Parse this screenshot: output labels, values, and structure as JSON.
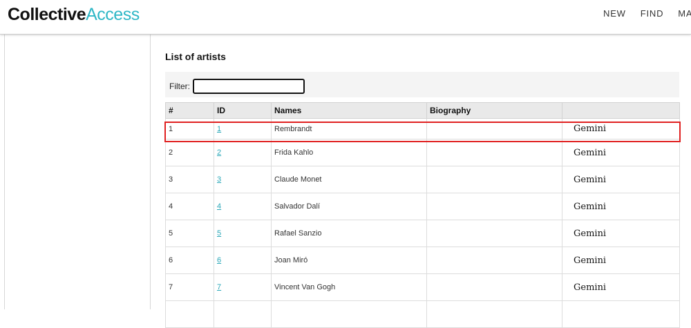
{
  "app": {
    "logo_part1": "Collective",
    "logo_part2": "Access"
  },
  "nav": {
    "items": [
      "NEW",
      "FIND",
      "MAN"
    ]
  },
  "page": {
    "heading": "List of artists"
  },
  "filter": {
    "label": "Filter:",
    "value": ""
  },
  "table": {
    "headers": [
      "#",
      "ID",
      "Names",
      "Biography",
      ""
    ],
    "rows": [
      {
        "num": "1",
        "id": "1",
        "name": "Rembrandt",
        "bio": "",
        "logo": "Gemini"
      },
      {
        "num": "2",
        "id": "2",
        "name": "Frida Kahlo",
        "bio": "",
        "logo": "Gemini"
      },
      {
        "num": "3",
        "id": "3",
        "name": "Claude Monet",
        "bio": "",
        "logo": "Gemini"
      },
      {
        "num": "4",
        "id": "4",
        "name": "Salvador Dalí",
        "bio": "",
        "logo": "Gemini"
      },
      {
        "num": "5",
        "id": "5",
        "name": "Rafael Sanzio",
        "bio": "",
        "logo": "Gemini"
      },
      {
        "num": "6",
        "id": "6",
        "name": "Joan Miró",
        "bio": "",
        "logo": "Gemini"
      },
      {
        "num": "7",
        "id": "7",
        "name": "Vincent Van Gogh",
        "bio": "",
        "logo": "Gemini"
      }
    ]
  },
  "colors": {
    "accent": "#2eb7c6",
    "highlight": "#e02020"
  }
}
